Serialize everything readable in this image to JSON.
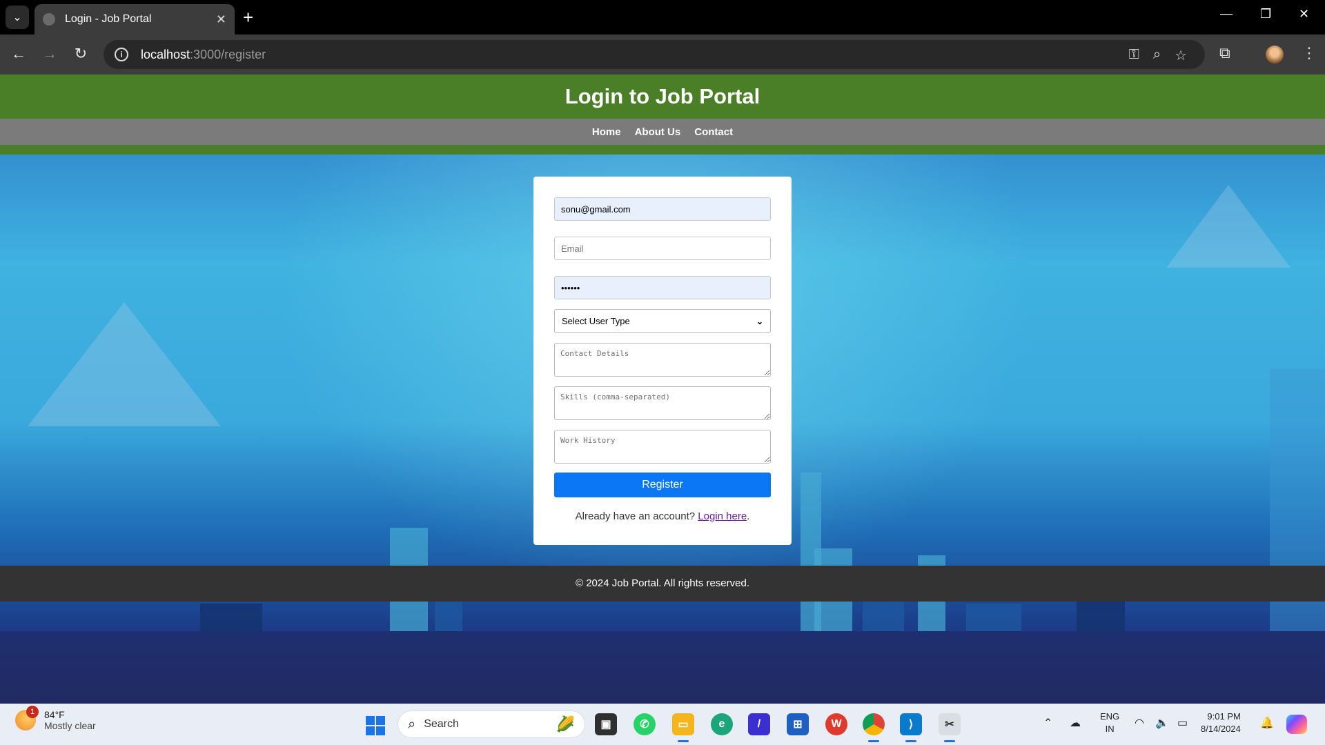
{
  "browser": {
    "tab_title": "Login - Job Portal",
    "url_host": "localhost",
    "url_rest": ":3000/register"
  },
  "page": {
    "header_title": "Login to Job Portal",
    "nav": [
      "Home",
      "About Us",
      "Contact"
    ],
    "form": {
      "username_value": "sonu@gmail.com",
      "email_placeholder": "Email",
      "password_value": "••••••",
      "select_value": "Select User Type",
      "contact_placeholder": "Contact Details",
      "skills_placeholder": "Skills (comma-separated)",
      "work_placeholder": "Work History",
      "register_label": "Register",
      "login_prompt": "Already have an account?",
      "login_link": "Login here",
      "login_suffix": "."
    },
    "footer": "© 2024 Job Portal. All rights reserved."
  },
  "taskbar": {
    "weather_temp": "84°F",
    "weather_desc": "Mostly clear",
    "weather_badge": "1",
    "search_label": "Search",
    "lang_line1": "ENG",
    "lang_line2": "IN",
    "time": "9:01 PM",
    "date": "8/14/2024"
  },
  "colors": {
    "header_green": "#4a7f27",
    "nav_gray": "#7b7b7b",
    "button_blue": "#0b77f5",
    "footer_dark": "#333333"
  },
  "icons": [
    "tab-list-icon",
    "globe-icon",
    "close-icon",
    "plus-icon",
    "minimize-icon",
    "restore-icon",
    "window-close-icon",
    "back-icon",
    "forward-icon",
    "reload-icon",
    "info-icon",
    "key-icon",
    "zoom-icon",
    "star-icon",
    "extensions-icon",
    "more-icon"
  ]
}
